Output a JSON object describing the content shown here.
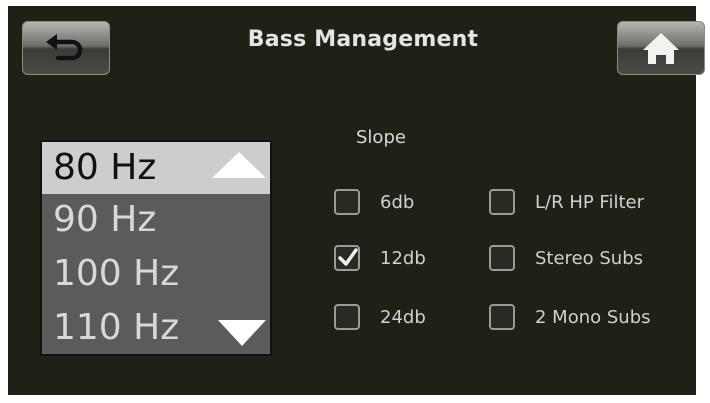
{
  "header": {
    "title": "Bass Management",
    "back_icon": "back-arrow-icon",
    "home_icon": "home-icon"
  },
  "frequency_list": {
    "items": [
      "80 Hz",
      "90 Hz",
      "100 Hz",
      "110 Hz"
    ],
    "selected": "80 Hz",
    "up_icon": "triangle-up-icon",
    "down_icon": "triangle-down-icon"
  },
  "slope": {
    "label": "Slope",
    "options": [
      {
        "label": "6db",
        "checked": false
      },
      {
        "label": "12db",
        "checked": true
      },
      {
        "label": "24db",
        "checked": false
      }
    ]
  },
  "filters": {
    "options": [
      {
        "label": "L/R HP Filter",
        "checked": false
      },
      {
        "label": "Stereo Subs",
        "checked": false
      },
      {
        "label": "2 Mono Subs",
        "checked": false
      }
    ]
  },
  "colors": {
    "screen_background": "#212016",
    "list_background": "#5b5b59",
    "list_selected": "#cdcdcd",
    "text": "#d8d8d8"
  }
}
